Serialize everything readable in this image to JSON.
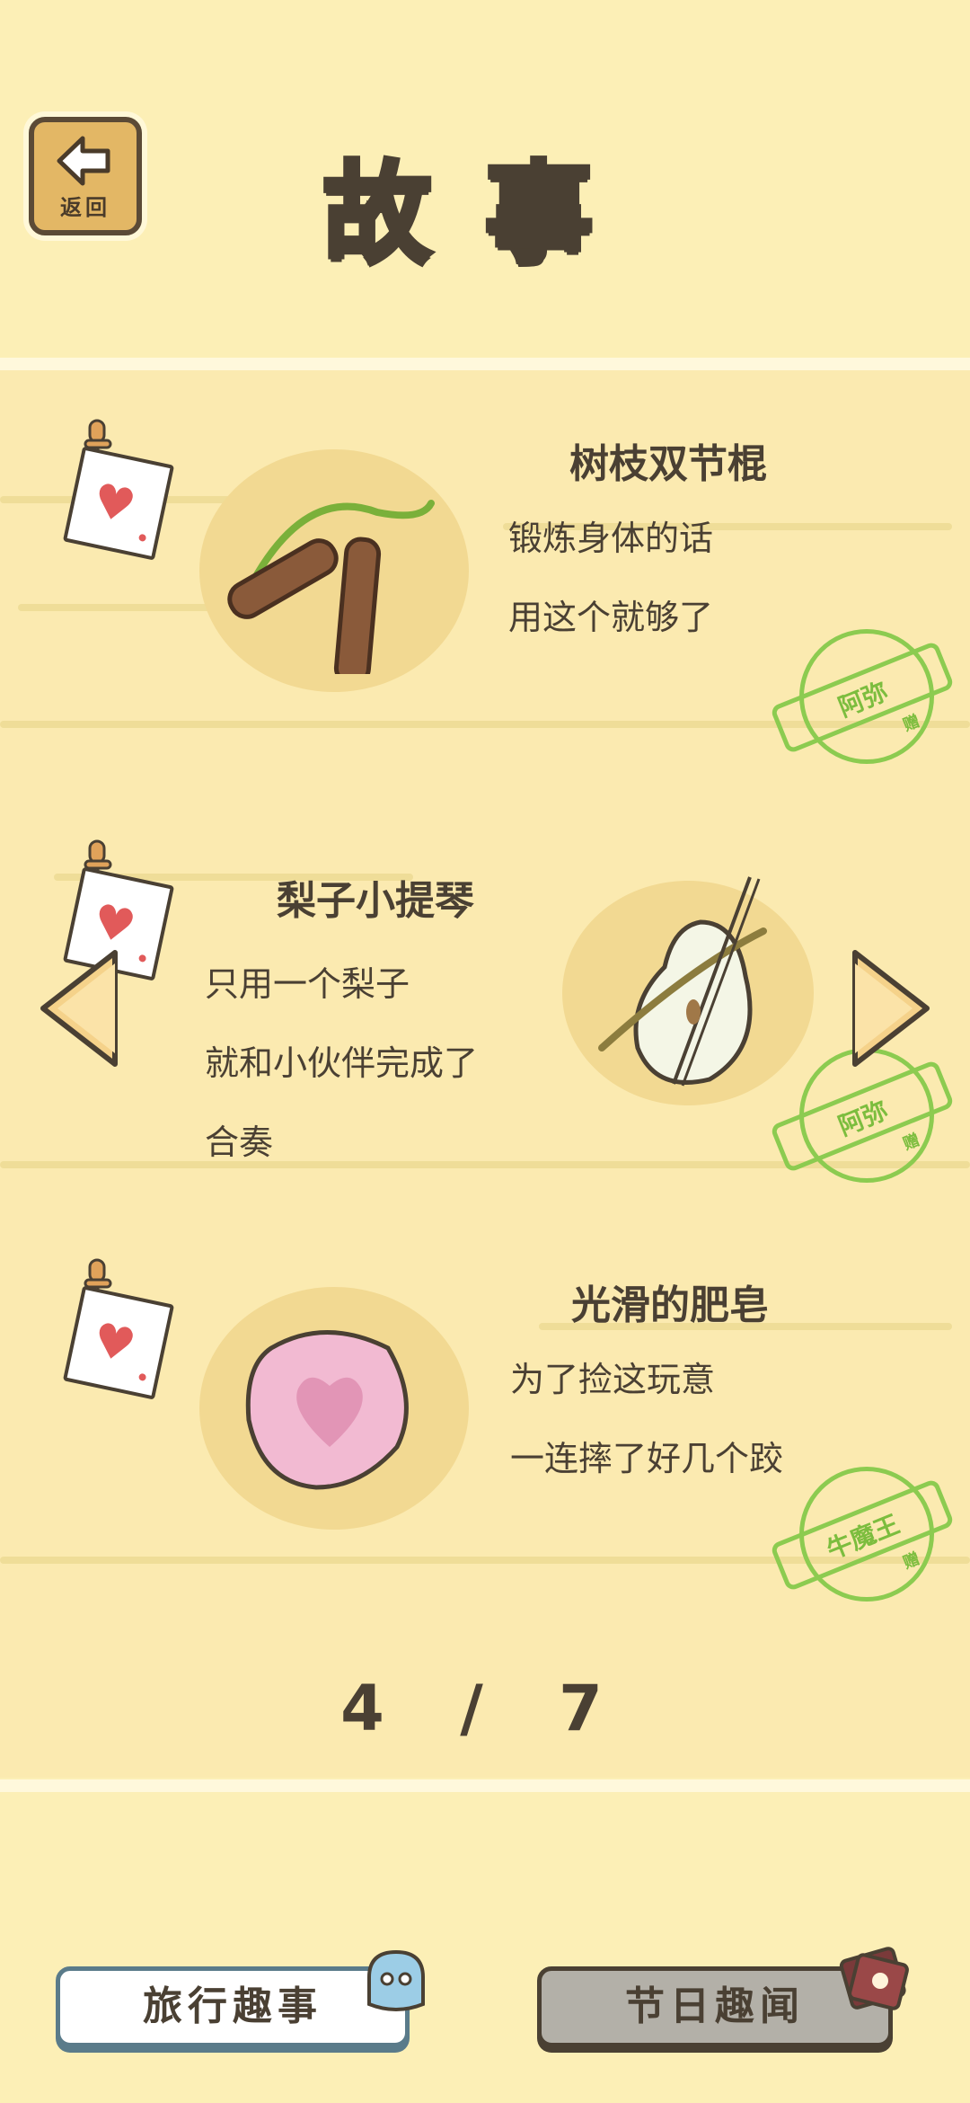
{
  "header": {
    "back_label": "返回",
    "title": "故事"
  },
  "stories": [
    {
      "title": "树枝双节棍",
      "lines": [
        "锻炼身体的话",
        "用这个就够了"
      ],
      "stamp_name": "阿弥",
      "stamp_note": "赠"
    },
    {
      "title": "梨子小提琴",
      "lines": [
        "只用一个梨子",
        "就和小伙伴完成了",
        "合奏"
      ],
      "stamp_name": "阿弥",
      "stamp_note": "赠"
    },
    {
      "title": "光滑的肥皂",
      "lines": [
        "为了捡这玩意",
        "一连摔了好几个跤"
      ],
      "stamp_name": "牛魔王",
      "stamp_note": "赠"
    }
  ],
  "pagination": {
    "current": "4",
    "separator": "/",
    "total": "7",
    "text": "4 / 7"
  },
  "tabs": {
    "travel_label": "旅行趣事",
    "holiday_label": "节日趣闻"
  },
  "colors": {
    "background": "#fcefb6",
    "stamp_green": "#8ccb50",
    "heart_red": "#e15a5a",
    "text_dark": "#4a4033"
  }
}
